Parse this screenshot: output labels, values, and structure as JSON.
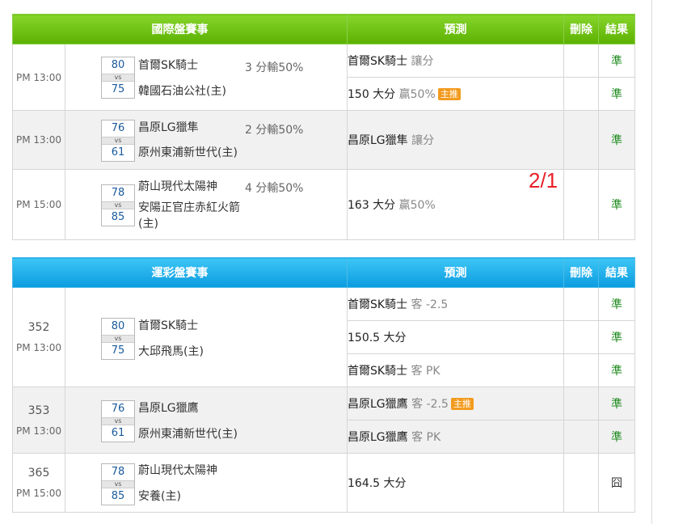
{
  "international": {
    "header": {
      "title": "國際盤賽事",
      "prediction": "預測",
      "delete": "刪除",
      "result": "結果"
    },
    "games": [
      {
        "time": "PM 13:00",
        "away": {
          "name": "首爾SK騎士",
          "score": "80"
        },
        "home": {
          "name": "韓國石油公社(主)",
          "score": "75"
        },
        "vs": "vs",
        "handicap": "3 分輸50%",
        "preds": [
          {
            "team": "首爾SK騎士",
            "detail": "讓分",
            "tag": "",
            "result": "準"
          },
          {
            "team": "150 大分",
            "detail": "贏50%",
            "tag": "主推",
            "result": "準"
          }
        ]
      },
      {
        "time": "PM 13:00",
        "away": {
          "name": "昌原LG獵隼",
          "score": "76"
        },
        "home": {
          "name": "原州東浦新世代(主)",
          "score": "61"
        },
        "vs": "vs",
        "handicap": "2 分輸50%",
        "preds": [
          {
            "team": "昌原LG獵隼",
            "detail": "讓分",
            "tag": "",
            "result": "準"
          }
        ]
      },
      {
        "time": "PM 15:00",
        "away": {
          "name": "蔚山現代太陽神",
          "score": "78"
        },
        "home": {
          "name": "安陽正官庄赤紅火箭(主)",
          "score": "85"
        },
        "vs": "vs",
        "handicap": "4 分輸50%",
        "preds": [
          {
            "team": "163 大分",
            "detail": "贏50%",
            "tag": "",
            "result": "準"
          }
        ]
      }
    ]
  },
  "lottery": {
    "header": {
      "title": "運彩盤賽事",
      "prediction": "預測",
      "delete": "刪除",
      "result": "結果"
    },
    "games": [
      {
        "id": "352",
        "time": "PM 13:00",
        "away": {
          "name": "首爾SK騎士",
          "score": "80"
        },
        "home": {
          "name": "大邱飛馬(主)",
          "score": "75"
        },
        "vs": "vs",
        "preds": [
          {
            "team": "首爾SK騎士",
            "detail": "客 -2.5",
            "tag": "",
            "result": "準"
          },
          {
            "team": "150.5 大分",
            "detail": "",
            "tag": "",
            "result": "準"
          },
          {
            "team": "首爾SK騎士",
            "detail": "客 PK",
            "tag": "",
            "result": "準"
          }
        ]
      },
      {
        "id": "353",
        "time": "PM 13:00",
        "away": {
          "name": "昌原LG獵鷹",
          "score": "76"
        },
        "home": {
          "name": "原州東浦新世代(主)",
          "score": "61"
        },
        "vs": "vs",
        "preds": [
          {
            "team": "昌原LG獵鷹",
            "detail": "客 -2.5",
            "tag": "主推",
            "result": "準"
          },
          {
            "team": "昌原LG獵鷹",
            "detail": "客 PK",
            "tag": "",
            "result": "準"
          }
        ]
      },
      {
        "id": "365",
        "time": "PM 15:00",
        "away": {
          "name": "蔚山現代太陽神",
          "score": "78"
        },
        "home": {
          "name": "安養(主)",
          "score": "85"
        },
        "vs": "vs",
        "preds": [
          {
            "team": "164.5 大分",
            "detail": "",
            "tag": "",
            "result": "囧"
          }
        ]
      }
    ]
  },
  "annotation": "2/1"
}
